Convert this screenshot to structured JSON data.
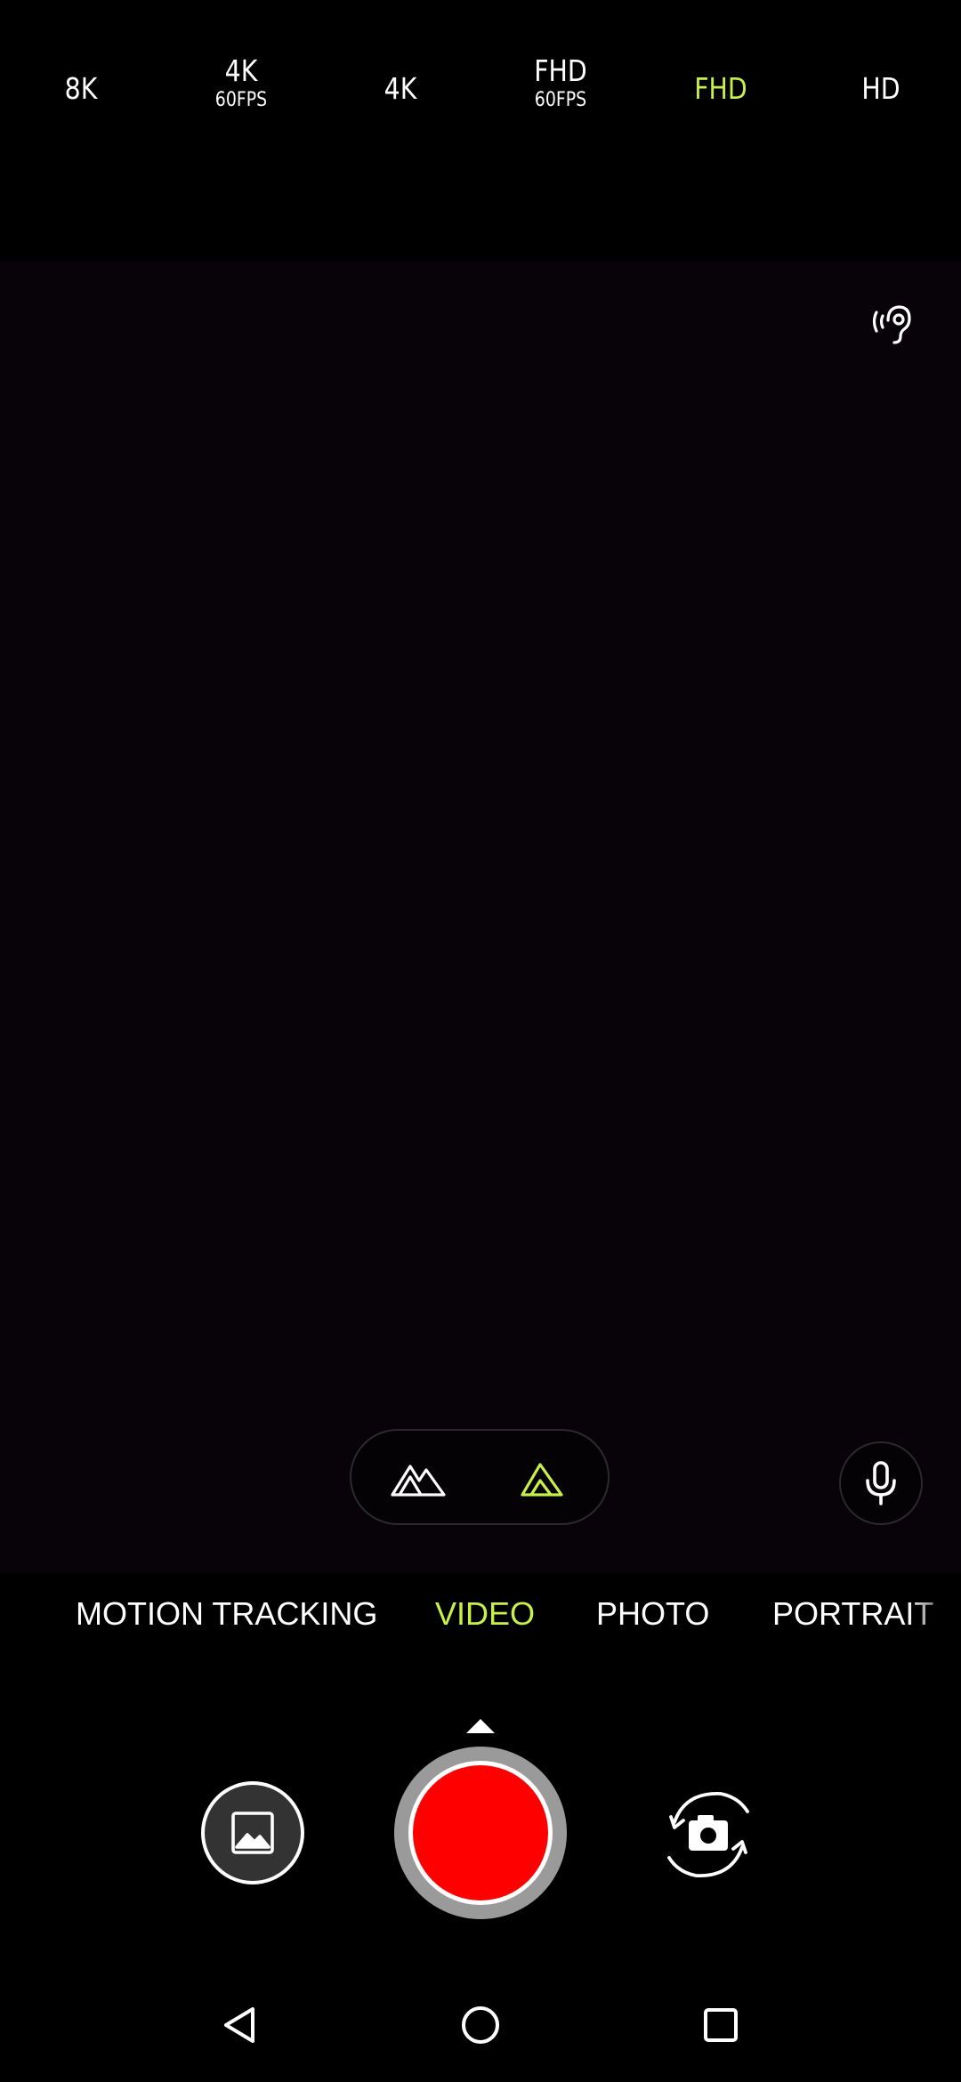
{
  "colors": {
    "accent": "#c8f04a",
    "record": "#ff0000",
    "background": "#000000",
    "viewfinder": "#070308"
  },
  "resolution_options": [
    {
      "label": "8K",
      "sub": "",
      "selected": false
    },
    {
      "label": "4K",
      "sub": "60FPS",
      "selected": false
    },
    {
      "label": "4K",
      "sub": "",
      "selected": false
    },
    {
      "label": "FHD",
      "sub": "60FPS",
      "selected": false
    },
    {
      "label": "FHD",
      "sub": "",
      "selected": true
    },
    {
      "label": "HD",
      "sub": "",
      "selected": false
    }
  ],
  "modes": [
    {
      "label": "MOTION TRACKING",
      "selected": false
    },
    {
      "label": "VIDEO",
      "selected": true
    },
    {
      "label": "PHOTO",
      "selected": false
    },
    {
      "label": "PORTRAIT",
      "selected": false
    }
  ],
  "icons": {
    "hearing": "hearing-icon",
    "lens_wide": "wide-angle-lens-icon",
    "lens_standard": "standard-lens-icon",
    "microphone": "microphone-icon",
    "gallery": "gallery-icon",
    "switch_camera": "switch-camera-icon",
    "nav_back": "back-icon",
    "nav_home": "home-icon",
    "nav_recents": "recents-icon"
  },
  "lens": {
    "selected": "standard"
  }
}
